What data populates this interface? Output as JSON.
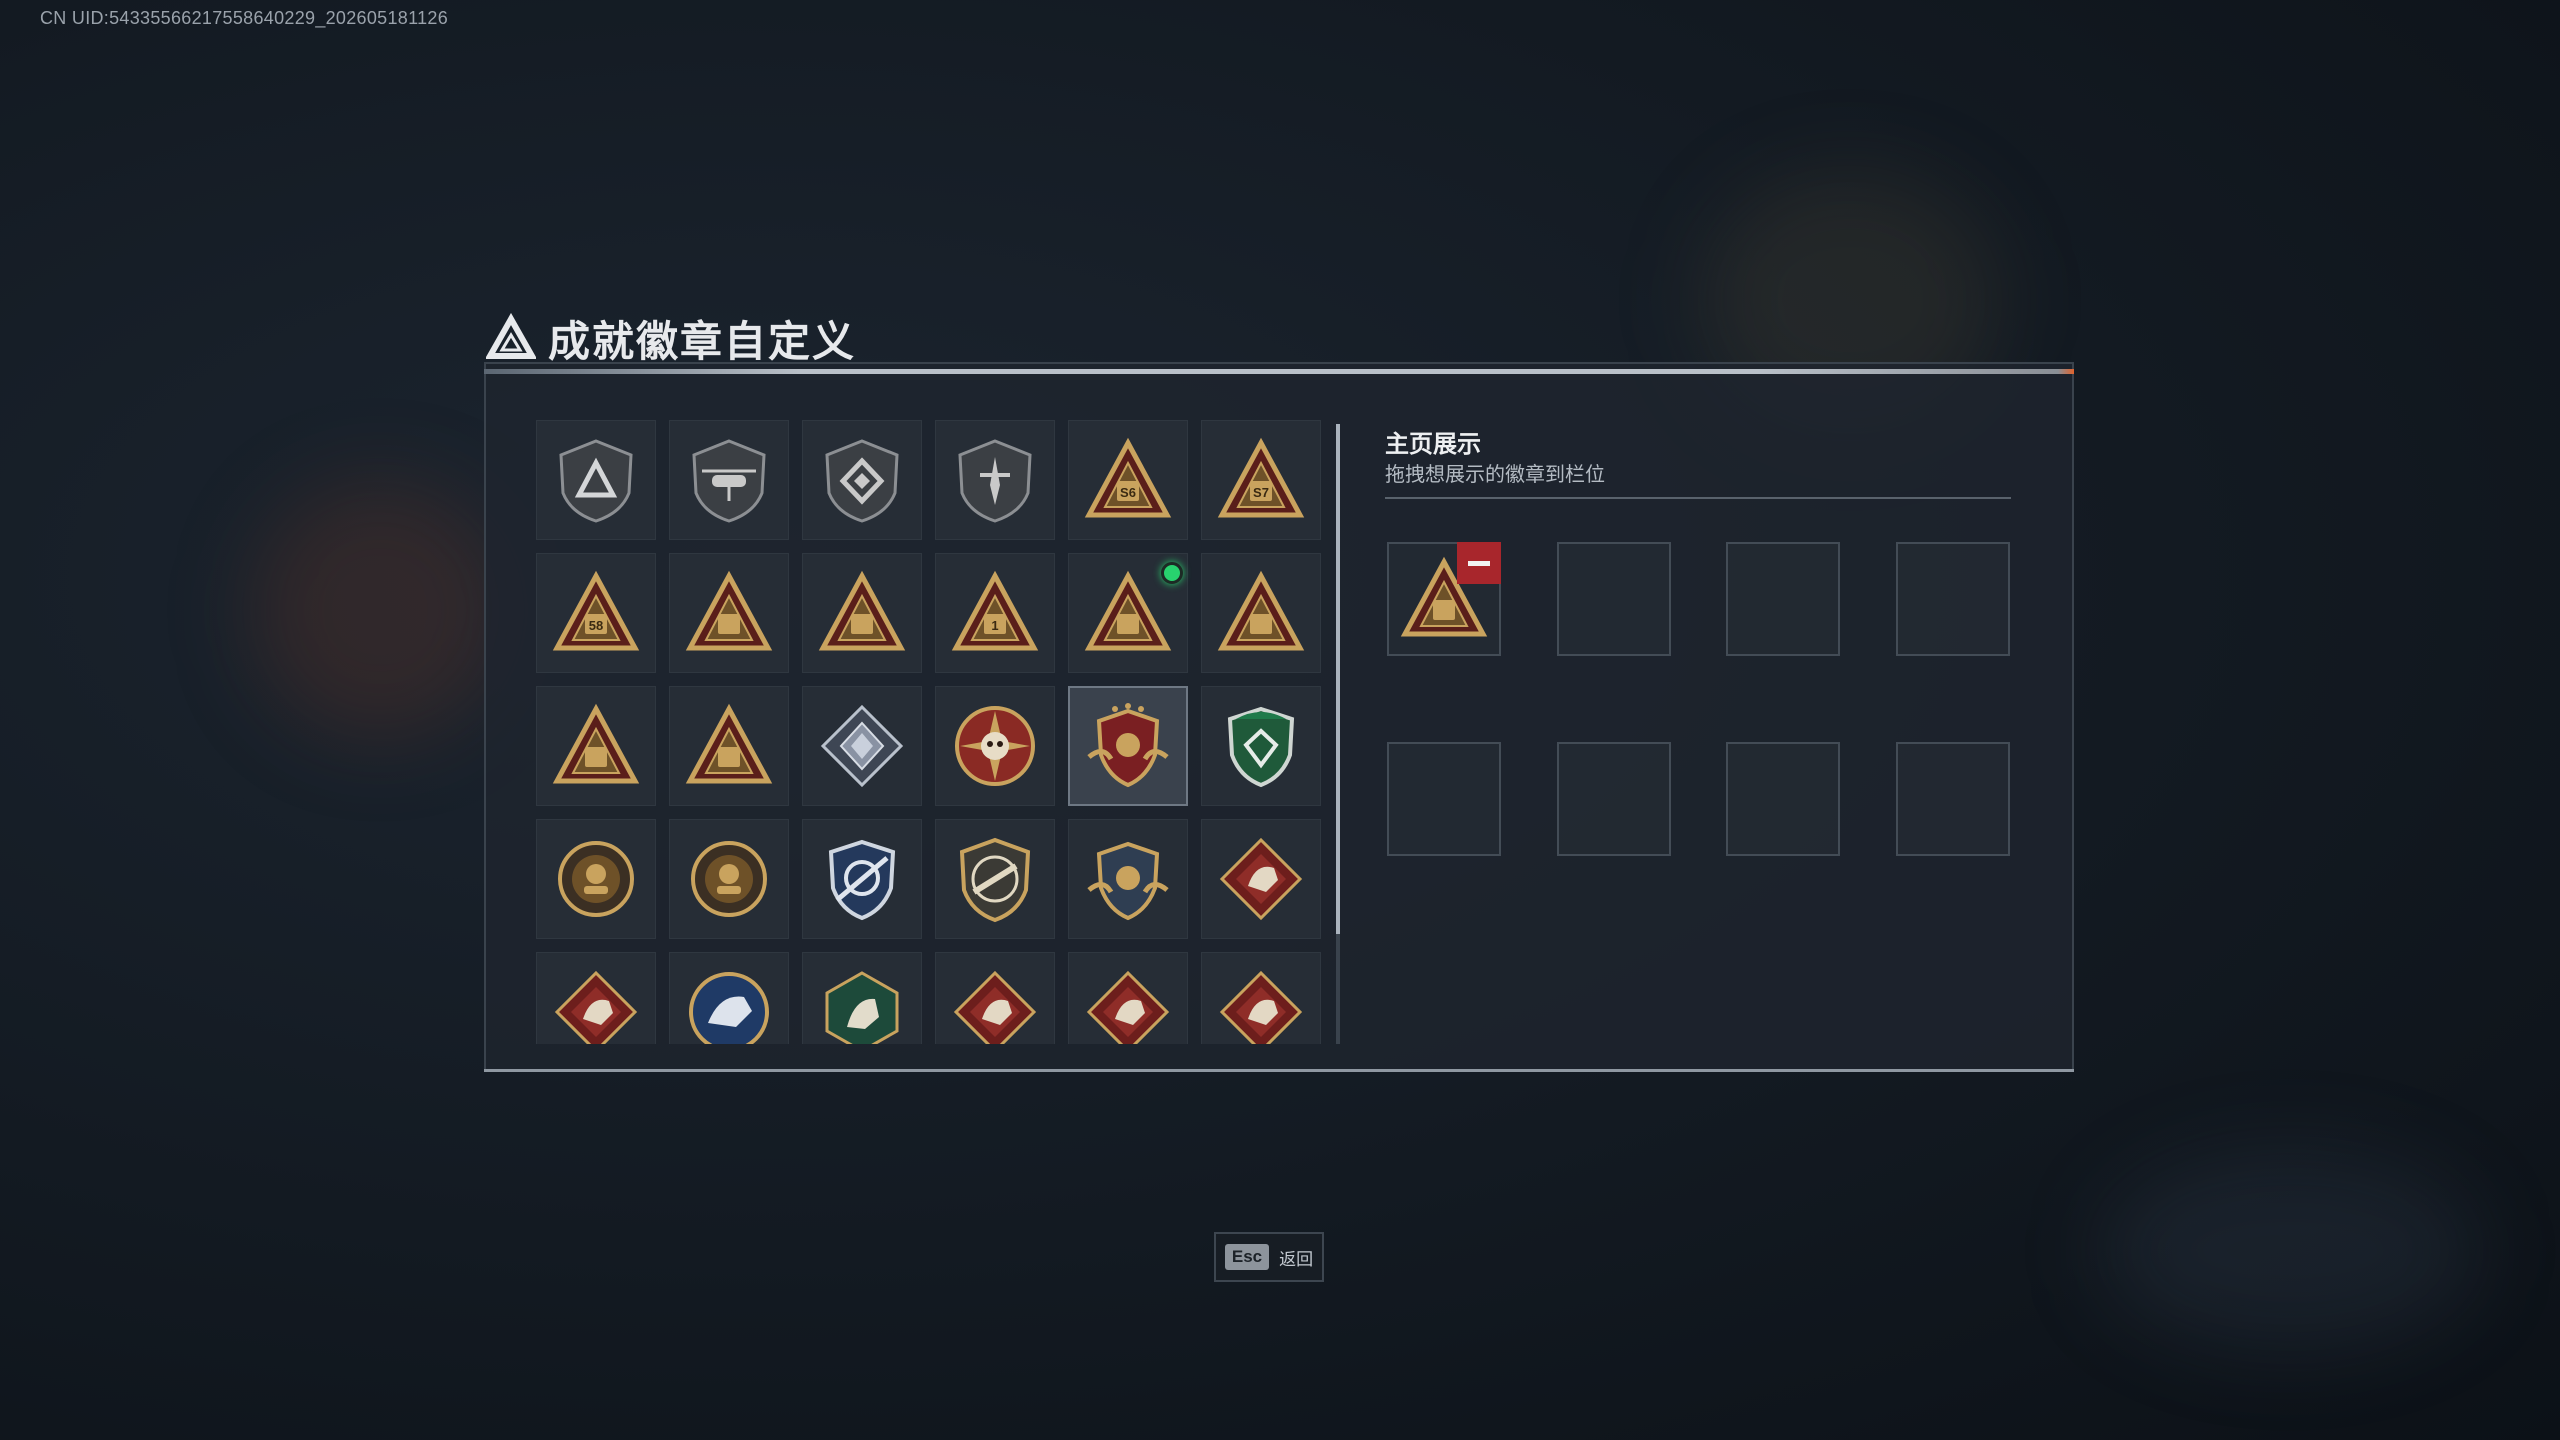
{
  "uid_text": "CN UID:543355662175586402​29_202605181126",
  "title": "成就徽章自定义",
  "title_deco": "",
  "badges": [
    {
      "name": "shield-triangle-emblem-icon",
      "kind": "shield-tri"
    },
    {
      "name": "helicopter-shield-emblem-icon",
      "kind": "shield-heli"
    },
    {
      "name": "diamond-shield-emblem-icon",
      "kind": "shield-diamond"
    },
    {
      "name": "dagger-shield-emblem-icon",
      "kind": "shield-dagger"
    },
    {
      "name": "s6-triangle-badge-icon",
      "kind": "tri",
      "label": "S6"
    },
    {
      "name": "s7-triangle-badge-icon",
      "kind": "tri",
      "label": "S7"
    },
    {
      "name": "s8-triangle-badge-icon",
      "kind": "tri",
      "label": "58"
    },
    {
      "name": "robot-triangle-badge-icon",
      "kind": "tri",
      "label": ""
    },
    {
      "name": "ship-triangle-badge-icon",
      "kind": "tri",
      "label": ""
    },
    {
      "name": "number-one-triangle-badge-icon",
      "kind": "tri",
      "label": "1"
    },
    {
      "name": "bag-triangle-badge-icon",
      "kind": "tri",
      "label": ""
    },
    {
      "name": "soldier-triangle-badge-icon",
      "kind": "tri",
      "label": ""
    },
    {
      "name": "beast-triangle-badge-icon",
      "kind": "tri",
      "label": ""
    },
    {
      "name": "rocket-triangle-badge-icon",
      "kind": "tri",
      "label": ""
    },
    {
      "name": "crystal-diamond-badge-icon",
      "kind": "crystal"
    },
    {
      "name": "skull-star-medal-icon",
      "kind": "skull-medal"
    },
    {
      "name": "winged-shield-crest-icon",
      "kind": "crest"
    },
    {
      "name": "green-shield-badge-icon",
      "kind": "green-shield"
    },
    {
      "name": "soldier-round-badge-icon",
      "kind": "round"
    },
    {
      "name": "skull-round-badge-icon",
      "kind": "round"
    },
    {
      "name": "sniper-blue-badge-icon",
      "kind": "blue-sniper"
    },
    {
      "name": "rifle-shield-badge-icon",
      "kind": "shield-rifle"
    },
    {
      "name": "crossed-guns-crest-icon",
      "kind": "crest-guns"
    },
    {
      "name": "wolf-red-diamond-badge-icon",
      "kind": "red-diamond"
    },
    {
      "name": "wolf-head-red-diamond-badge-icon",
      "kind": "red-diamond"
    },
    {
      "name": "eagle-blue-round-badge-icon",
      "kind": "blue-round"
    },
    {
      "name": "goat-green-hex-badge-icon",
      "kind": "green-hex"
    },
    {
      "name": "dragon-red-diamond-badge-icon",
      "kind": "red-diamond"
    },
    {
      "name": "dragon-head-red-diamond-badge-icon",
      "kind": "red-diamond"
    },
    {
      "name": "runner-red-diamond-badge-icon",
      "kind": "red-diamond"
    }
  ],
  "selected_index": 16,
  "new_dot_index": 10,
  "showcase": {
    "title": "主页展示",
    "subtitle": "拖拽想展示的徽章到栏位",
    "slots": [
      "bag-triangle-badge-icon",
      null,
      null,
      null,
      null,
      null,
      null,
      null
    ]
  },
  "footer": {
    "esc_key": "Esc",
    "esc_label": "返回"
  },
  "colors": {
    "gold": "#c9a35e",
    "gold_dark": "#6e5128",
    "red_accent": "#a8262c",
    "new_dot": "#28d36e",
    "panel_bg": "#1e252e"
  }
}
